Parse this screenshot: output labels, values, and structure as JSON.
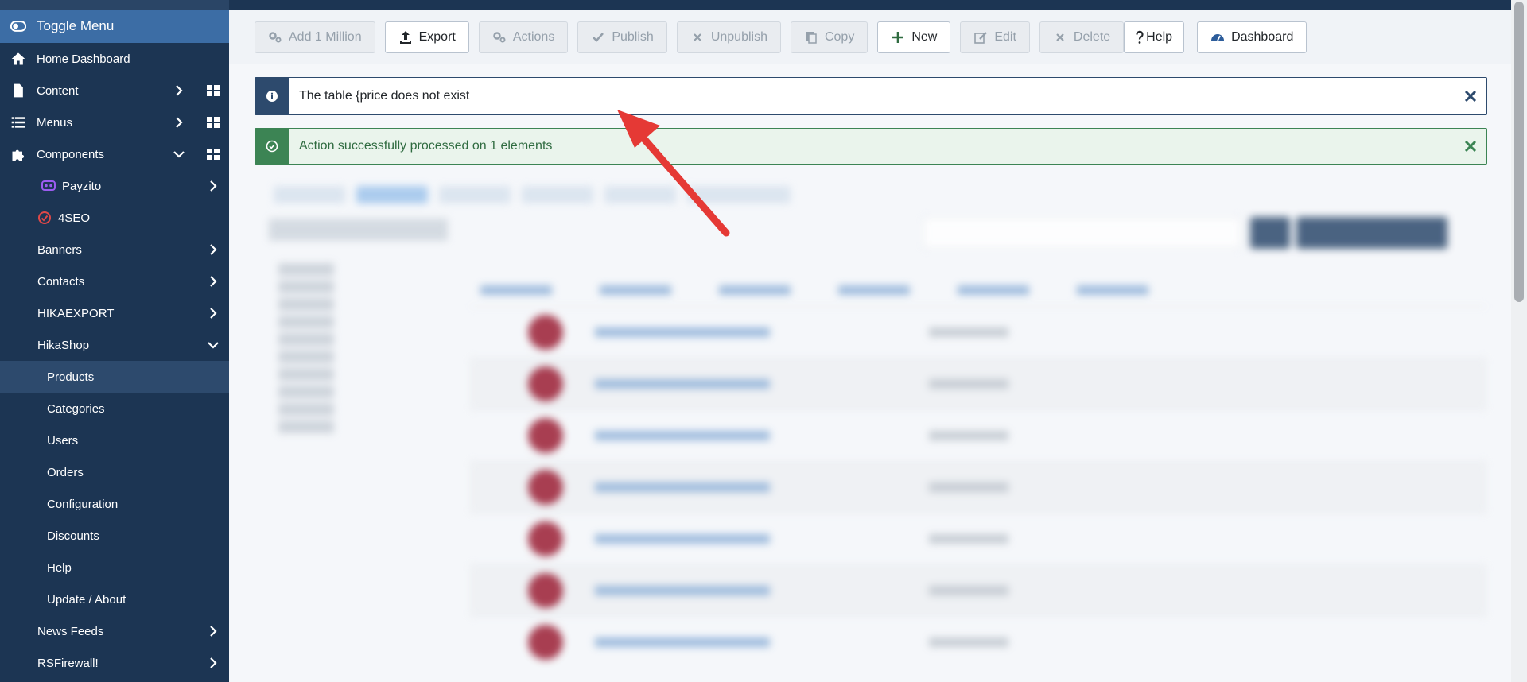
{
  "sidebar": {
    "toggle_label": "Toggle Menu",
    "items": [
      {
        "label": "Home Dashboard"
      },
      {
        "label": "Content"
      },
      {
        "label": "Menus"
      },
      {
        "label": "Components"
      },
      {
        "label": "Payzito"
      },
      {
        "label": "4SEO"
      },
      {
        "label": "Banners"
      },
      {
        "label": "Contacts"
      },
      {
        "label": "HIKAEXPORT"
      },
      {
        "label": "HikaShop"
      },
      {
        "label": "Products"
      },
      {
        "label": "Categories"
      },
      {
        "label": "Users"
      },
      {
        "label": "Orders"
      },
      {
        "label": "Configuration"
      },
      {
        "label": "Discounts"
      },
      {
        "label": "Help"
      },
      {
        "label": "Update / About"
      },
      {
        "label": "News Feeds"
      },
      {
        "label": "RSFirewall!"
      }
    ],
    "active_item": "Products"
  },
  "toolbar": {
    "add_million": "Add 1 Million",
    "export": "Export",
    "actions": "Actions",
    "publish": "Publish",
    "unpublish": "Unpublish",
    "copy": "Copy",
    "new": "New",
    "edit": "Edit",
    "delete": "Delete",
    "help": "Help",
    "dashboard": "Dashboard"
  },
  "alerts": {
    "info_text": "The table {price does not exist",
    "success_text": "Action successfully processed on 1 elements"
  },
  "colors": {
    "sidebar_bg": "#1c3553",
    "toggle_bg": "#3c6da5",
    "info_accent": "#2d4a6d",
    "success_accent": "#3c8454",
    "annotation_arrow": "#e53935"
  },
  "icons": {
    "toggle": "toggle-icon",
    "home": "home-icon",
    "content": "file-icon",
    "menus": "list-icon",
    "components": "puzzle-icon",
    "info": "info-icon",
    "success": "check-circle-icon",
    "close": "close-icon"
  }
}
